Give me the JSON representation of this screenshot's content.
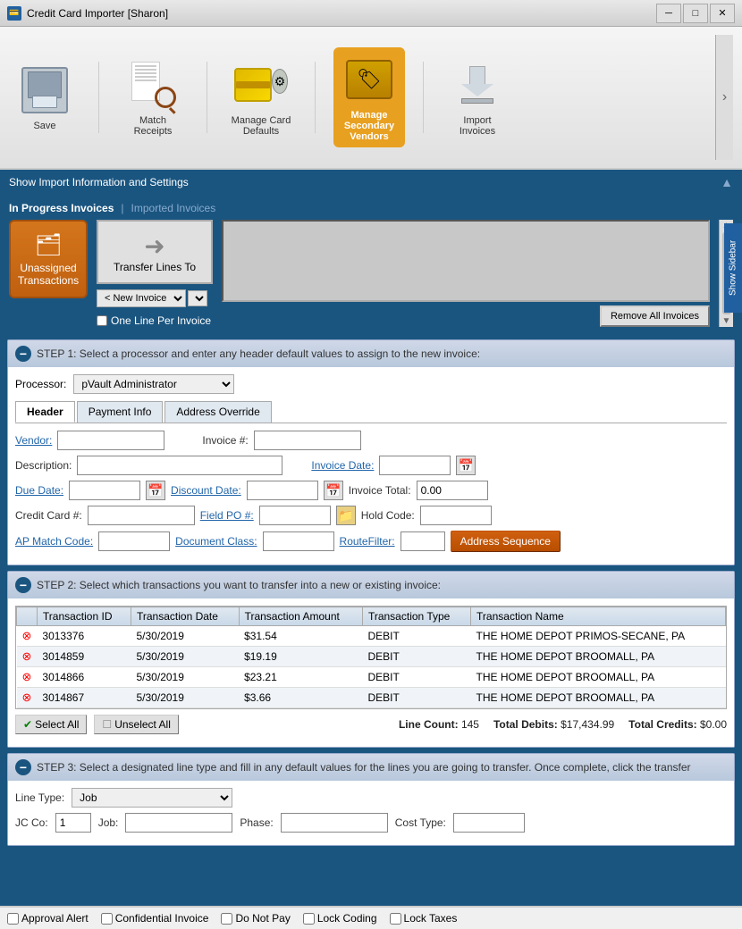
{
  "window": {
    "title": "Credit Card Importer [Sharon]"
  },
  "toolbar": {
    "items": [
      {
        "id": "save",
        "label": "Save",
        "icon": "save-icon"
      },
      {
        "id": "match-receipts",
        "label": "Match Receipts",
        "icon": "receipt-icon"
      },
      {
        "id": "manage-card",
        "label": "Manage Card Defaults",
        "icon": "card-icon"
      },
      {
        "id": "manage-vendors",
        "label": "Manage Secondary Vendors",
        "icon": "vendors-icon",
        "active": true
      },
      {
        "id": "import-invoices",
        "label": "Import Invoices",
        "icon": "import-icon"
      }
    ]
  },
  "sidebar": {
    "label": "Show Sidebar"
  },
  "import_info_bar": {
    "label": "Show Import Information and Settings"
  },
  "invoice_section": {
    "in_progress_label": "In Progress Invoices",
    "separator": "|",
    "imported_label": "Imported Invoices",
    "transfer_label": "Transfer Lines To",
    "new_invoice_value": "< New Invoice >",
    "one_line_label": "One Line Per Invoice",
    "remove_all_label": "Remove All Invoices"
  },
  "unassigned": {
    "label": "Unassigned Transactions"
  },
  "step1": {
    "title": "STEP 1: Select a processor and enter any header default values to assign to the new invoice:",
    "processor_label": "Processor:",
    "processor_value": "pVault Administrator",
    "tabs": [
      "Header",
      "Payment Info",
      "Address Override"
    ],
    "active_tab": "Header",
    "fields": {
      "vendor_label": "Vendor:",
      "invoice_num_label": "Invoice #:",
      "description_label": "Description:",
      "invoice_date_label": "Invoice Date:",
      "due_date_label": "Due Date:",
      "discount_date_label": "Discount Date:",
      "invoice_total_label": "Invoice Total:",
      "invoice_total_value": "0.00",
      "credit_card_label": "Credit Card #:",
      "field_po_label": "Field PO #:",
      "hold_code_label": "Hold Code:",
      "ap_match_label": "AP Match Code:",
      "doc_class_label": "Document Class:",
      "route_filter_label": "RouteFilter:",
      "addr_seq_label": "Address Sequence"
    }
  },
  "step2": {
    "title": "STEP 2: Select which transactions you want to transfer into a new or existing invoice:",
    "columns": [
      "Transaction ID",
      "Transaction Date",
      "Transaction Amount",
      "Transaction Type",
      "Transaction Name"
    ],
    "rows": [
      {
        "id": "3013376",
        "date": "5/30/2019",
        "amount": "$31.54",
        "type": "DEBIT",
        "name": "THE HOME DEPOT PRIMOS-SECANE, PA"
      },
      {
        "id": "3014859",
        "date": "5/30/2019",
        "amount": "$19.19",
        "type": "DEBIT",
        "name": "THE HOME DEPOT BROOMALL, PA"
      },
      {
        "id": "3014866",
        "date": "5/30/2019",
        "amount": "$23.21",
        "type": "DEBIT",
        "name": "THE HOME DEPOT BROOMALL, PA"
      },
      {
        "id": "3014867",
        "date": "5/30/2019",
        "amount": "$3.66",
        "type": "DEBIT",
        "name": "THE HOME DEPOT BROOMALL, PA"
      }
    ],
    "select_all_label": "Select All",
    "unselect_all_label": "Unselect All",
    "line_count_label": "Line Count:",
    "line_count_value": "145",
    "total_debits_label": "Total Debits:",
    "total_debits_value": "$17,434.99",
    "total_credits_label": "Total Credits:",
    "total_credits_value": "$0.00"
  },
  "step3": {
    "title": "STEP 3: Select a designated line type and fill in any default values for the lines you are going to transfer. Once complete, click the transfer",
    "line_type_label": "Line Type:",
    "line_type_value": "Job",
    "fields": {
      "jc_co_label": "JC Co:",
      "jc_co_value": "1",
      "job_label": "Job:",
      "phase_label": "Phase:",
      "cost_type_label": "Cost Type:"
    }
  },
  "footer": {
    "checkboxes": [
      {
        "id": "approval-alert",
        "label": "Approval Alert",
        "checked": false
      },
      {
        "id": "confidential-invoice",
        "label": "Confidential Invoice",
        "checked": false
      },
      {
        "id": "do-not-pay",
        "label": "Do Not Pay",
        "checked": false
      },
      {
        "id": "lock-coding",
        "label": "Lock Coding",
        "checked": false
      },
      {
        "id": "lock-taxes",
        "label": "Lock Taxes",
        "checked": false
      }
    ]
  }
}
